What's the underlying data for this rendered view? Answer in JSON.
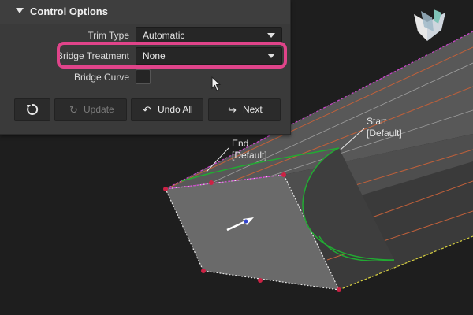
{
  "panel": {
    "section_title": "Control Options",
    "trim_type": {
      "label": "Trim Type",
      "value": "Automatic"
    },
    "bridge_treatment": {
      "label": "Bridge Treatment",
      "value": "None"
    },
    "bridge_curve": {
      "label": "Bridge Curve",
      "checked": false
    },
    "buttons": {
      "reset_icon": "reset-icon",
      "update": {
        "label": "Update",
        "icon": "refresh-icon",
        "enabled": false
      },
      "undo_all": {
        "label": "Undo All",
        "icon": "undo-icon"
      },
      "next": {
        "label": "Next",
        "icon": "next-arrow-icon"
      }
    }
  },
  "viewport": {
    "start_label": [
      "Start",
      "[Default]"
    ],
    "end_label": [
      "End",
      "[Default]"
    ]
  },
  "colors": {
    "highlight": "#e0448a",
    "surface": "#5f5f5f",
    "edge_magenta": "#cc44cc",
    "edge_green": "#22aa33",
    "edge_yellow": "#d8d040",
    "iso_orange": "#c0603a"
  }
}
